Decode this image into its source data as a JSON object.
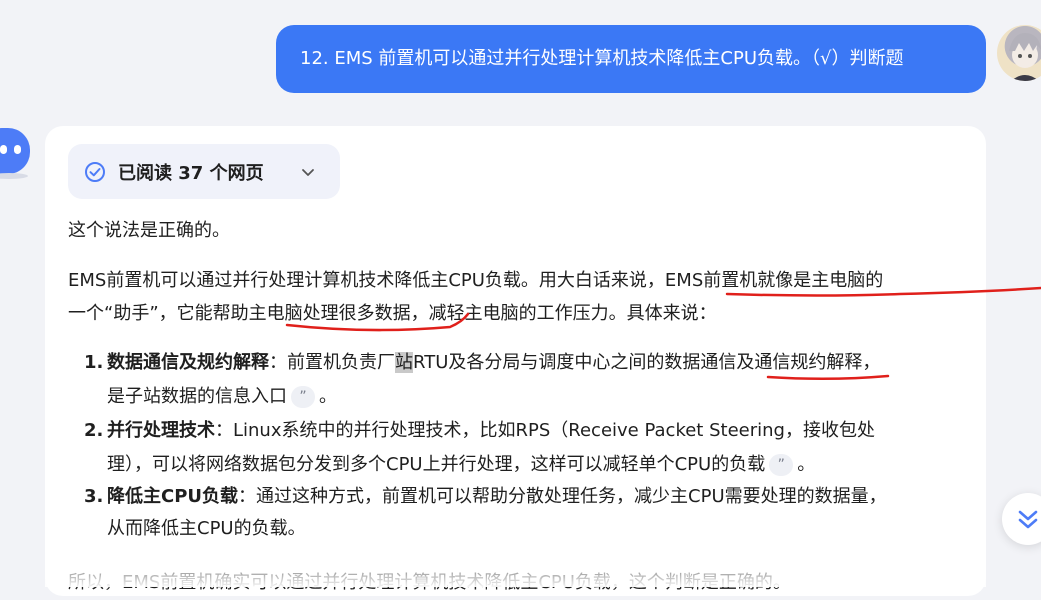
{
  "user_message": {
    "text": "12. EMS 前置机可以通过并行处理计算机技术降低主CPU负载。（√）判断题"
  },
  "answer": {
    "read_label": "已阅读 37 个网页",
    "p1": "这个说法是正确的。",
    "p2_line1": "EMS前置机可以通过并行处理计算机技术降低主CPU负载。用大白话来说，EMS前置机就像是主电脑的",
    "p2_line2": "一个“助手”，它能帮助主电脑处理很多数据，减轻主电脑的工作压力。具体来说：",
    "items": [
      {
        "num": "1.",
        "title": "数据通信及规约解释",
        "line1_a": "：前置机负责厂",
        "line1_hl": "站",
        "line1_b": "RTU及各分局与调度中心之间的数据通信及通信规约解释，",
        "line2": "是子站数据的信息入口",
        "line2_end": "。"
      },
      {
        "num": "2.",
        "title": "并行处理技术",
        "line1": "：Linux系统中的并行处理技术，比如RPS（Receive Packet Steering，接收包处",
        "line2": "理），可以将网络数据包分发到多个CPU上并行处理，这样可以减轻单个CPU的负载",
        "line2_end": "。"
      },
      {
        "num": "3.",
        "title": "降低主CPU负载",
        "line1": "：通过这种方式，前置机可以帮助分散处理任务，减少主CPU需要处理的数据量，",
        "line2": "从而降低主CPU的负载。"
      }
    ],
    "cite_glyph": "”",
    "last_line": "所以，EMS前置机确实可以通过并行处理计算机技术降低主CPU负载，这个判断是正确的。"
  },
  "icons": {
    "read_check": "check-circle-icon",
    "expand": "chevron-down-icon",
    "scroll_down": "double-chevron-down-icon"
  },
  "colors": {
    "user_bubble": "#3b78f5",
    "annotation_red": "#e0201b",
    "accent_blue": "#4d7cf7"
  }
}
